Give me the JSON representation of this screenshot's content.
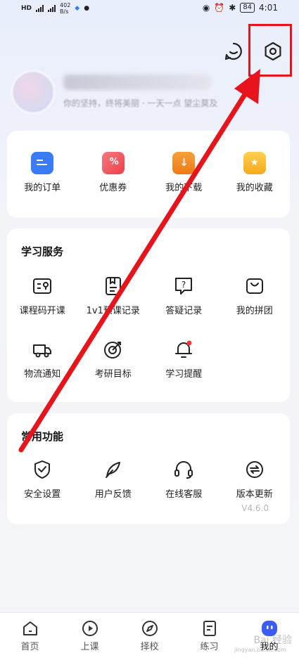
{
  "status_bar": {
    "net_speed_value": "402",
    "net_speed_unit": "B/s",
    "battery": "84",
    "time": "4:01"
  },
  "profile": {
    "motto": "你的坚持，终将美丽 · 一天一点 望尘莫及"
  },
  "orders": [
    {
      "label": "我的订单",
      "icon": "order-icon",
      "color": "#3b7cf6"
    },
    {
      "label": "优惠券",
      "icon": "coupon-icon",
      "color": "#f0525a"
    },
    {
      "label": "我的下载",
      "icon": "download-icon",
      "color": "#f28a1f"
    },
    {
      "label": "我的收藏",
      "icon": "favorite-icon",
      "color": "#f8b42a"
    }
  ],
  "study": {
    "title": "学习服务",
    "items": [
      {
        "label": "课程码开课",
        "icon": "course-code-icon"
      },
      {
        "label": "1v1预课记录",
        "icon": "record-icon"
      },
      {
        "label": "答疑记录",
        "icon": "qa-icon"
      },
      {
        "label": "我的拼团",
        "icon": "group-buy-icon"
      },
      {
        "label": "物流通知",
        "icon": "delivery-truck-icon"
      },
      {
        "label": "考研目标",
        "icon": "target-icon"
      },
      {
        "label": "学习提醒",
        "icon": "bell-icon"
      }
    ]
  },
  "common": {
    "title": "常用功能",
    "items": [
      {
        "label": "安全设置",
        "icon": "shield-icon"
      },
      {
        "label": "用户反馈",
        "icon": "feather-icon"
      },
      {
        "label": "在线客服",
        "icon": "headset-icon"
      },
      {
        "label": "版本更新",
        "icon": "refresh-icon"
      }
    ],
    "version": "V4.6.0"
  },
  "tabs": [
    {
      "label": "首页",
      "icon": "home-icon"
    },
    {
      "label": "上课",
      "icon": "play-icon"
    },
    {
      "label": "择校",
      "icon": "compass-icon"
    },
    {
      "label": "练习",
      "icon": "document-icon"
    },
    {
      "label": "我的",
      "icon": "profile-face-icon"
    }
  ],
  "watermark": {
    "text": "Bai 经验",
    "sub": "jingyan.baidu.com"
  },
  "colors": {
    "accent": "#3b5cf6",
    "annotation_red": "#e8141c"
  }
}
